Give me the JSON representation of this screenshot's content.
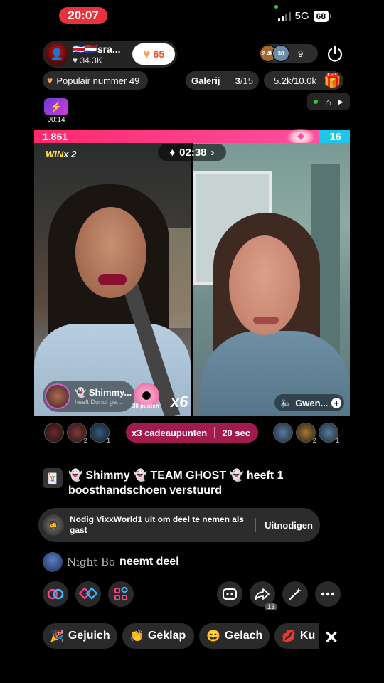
{
  "status": {
    "time": "20:07",
    "network": "5G",
    "battery": "68"
  },
  "host": {
    "name": "sra...",
    "likes": "34.3K",
    "flags": "🇨🇷🇳🇱",
    "follow_count": "65"
  },
  "viewers": {
    "count": "9",
    "badge1": "2.4K",
    "badge2": "30"
  },
  "rank": {
    "label": "Populair nummer 49"
  },
  "gallery": {
    "label": "Galerij",
    "count": "3",
    "total": "/15"
  },
  "goal": {
    "label": "5.2k/10.0k"
  },
  "timer_badge": {
    "time": "00:14"
  },
  "battle": {
    "score_left": "1.861",
    "score_right": "16",
    "timer": "02:38",
    "win_label": "WIN",
    "win_mult": "x 2"
  },
  "gift": {
    "sender": "Shimmy...",
    "sub": "heeft Donut ge...",
    "points": "30 punten",
    "multiplier": "x6"
  },
  "guest": {
    "name": "Gwen..."
  },
  "supporters_left_ranks": [
    "",
    "2",
    "1"
  ],
  "supporters_right_ranks": [
    "",
    "2",
    "1"
  ],
  "boost": {
    "label": "x3 cadeaupunten",
    "time": "20 sec"
  },
  "chat": {
    "message1": "👻 Shimmy 👻 TEAM GHOST 👻 heeft 1 boosthandschoen verstuurd",
    "invite_text": "Nodig VixxWorld1 uit om deel te nemen als gast",
    "invite_button": "Uitnodigen",
    "join_name": "Night Bo",
    "join_action": "neemt deel"
  },
  "actions": {
    "share_count": "13"
  },
  "reactions": [
    "Gejuich",
    "Geklap",
    "Gelach",
    "Ku"
  ],
  "colors": {
    "battle_pink": "#ff2a6d",
    "battle_blue": "#1ec6ea",
    "boost_red": "#a11b4c",
    "time_red": "#e8323c"
  }
}
